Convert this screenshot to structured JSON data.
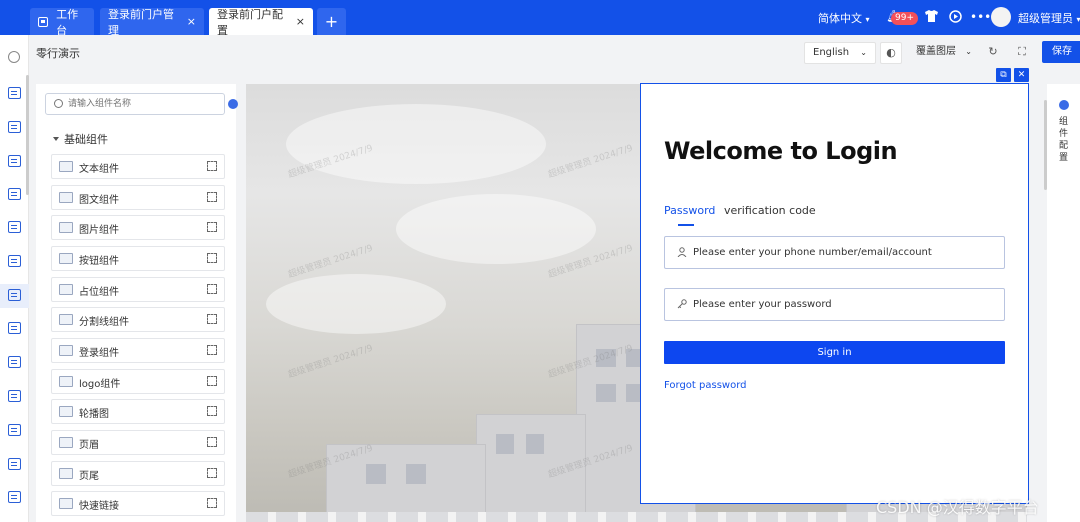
{
  "tabs": [
    {
      "label": "工作台"
    },
    {
      "label": "登录前门户管理",
      "close": "×"
    },
    {
      "label": "登录前门户配置",
      "close": "×"
    },
    {
      "label": "+"
    }
  ],
  "topbar": {
    "language": "简体中文",
    "notification_badge": "99+",
    "more": "•••",
    "username": "超级管理员"
  },
  "subbar": {
    "title": "零行演示",
    "language_select": "English",
    "layer_select": "覆盖图层",
    "save_label": "保存"
  },
  "panel": {
    "search_placeholder": "请输入组件名称",
    "group_title": "基础组件",
    "components": [
      {
        "label": "文本组件",
        "icon": "text-icon"
      },
      {
        "label": "图文组件",
        "icon": "image-text-icon"
      },
      {
        "label": "图片组件",
        "icon": "image-icon"
      },
      {
        "label": "按钮组件",
        "icon": "button-icon"
      },
      {
        "label": "占位组件",
        "icon": "placeholder-icon"
      },
      {
        "label": "分割线组件",
        "icon": "divider-icon"
      },
      {
        "label": "登录组件",
        "icon": "login-icon"
      },
      {
        "label": "logo组件",
        "icon": "logo-icon"
      },
      {
        "label": "轮播图",
        "icon": "carousel-icon"
      },
      {
        "label": "页眉",
        "icon": "header-icon"
      },
      {
        "label": "页尾",
        "icon": "footer-icon"
      },
      {
        "label": "快速链接",
        "icon": "link-icon"
      }
    ]
  },
  "login": {
    "title": "Welcome to Login",
    "tab_password": "Password",
    "tab_code": "verification code",
    "account_placeholder": "Please enter your phone number/email/account",
    "password_placeholder": "Please enter your password",
    "signin_label": "Sign in",
    "forgot_label": "Forgot password"
  },
  "rightrail": {
    "label": "组件配置"
  },
  "watermark_text": "超级管理员 2024/7/9",
  "csdn_watermark": "CSDN @汉得数字平台",
  "colors": {
    "primary": "#1351e8",
    "background": "#f2f3f5"
  }
}
